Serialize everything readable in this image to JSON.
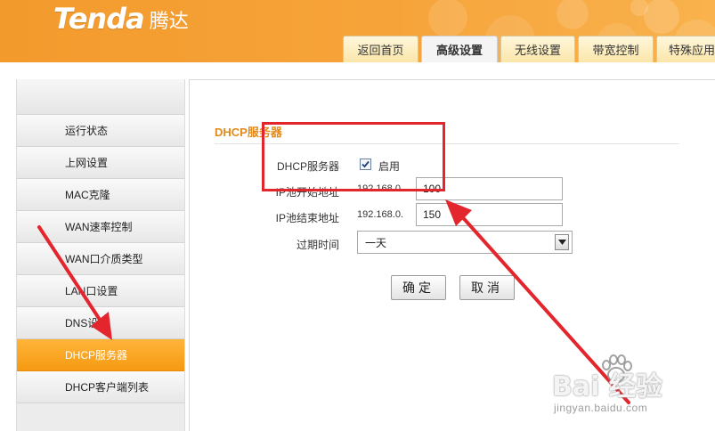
{
  "header": {
    "logo_text": "Tenda",
    "logo_cn": "腾达",
    "tabs": [
      {
        "label": "返回首页",
        "active": false
      },
      {
        "label": "高级设置",
        "active": true
      },
      {
        "label": "无线设置",
        "active": false
      },
      {
        "label": "带宽控制",
        "active": false
      },
      {
        "label": "特殊应用",
        "active": false
      }
    ]
  },
  "sidebar": {
    "items": [
      {
        "label": "运行状态"
      },
      {
        "label": "上网设置"
      },
      {
        "label": "MAC克隆"
      },
      {
        "label": "WAN速率控制"
      },
      {
        "label": "WAN口介质类型"
      },
      {
        "label": "LAN口设置"
      },
      {
        "label": "DNS设置"
      },
      {
        "label": "DHCP服务器",
        "active": true
      },
      {
        "label": "DHCP客户端列表"
      }
    ]
  },
  "main": {
    "section_title": "DHCP服务器",
    "dhcp_server_label": "DHCP服务器",
    "enable_label": "启用",
    "enable_checked": true,
    "ip_start_label": "IP池开始地址",
    "ip_start_prefix": "192.168.0.",
    "ip_start_value": "100",
    "ip_end_label": "IP池结束地址",
    "ip_end_prefix": "192.168.0.",
    "ip_end_value": "150",
    "lease_label": "过期时间",
    "lease_value": "一天",
    "ok_button": "确定",
    "cancel_button": "取消"
  },
  "watermark": {
    "main": "Bai 经验",
    "sub": "jingyan.baidu.com"
  },
  "colors": {
    "header_orange": "#f39a2c",
    "active_menu": "#f59a12",
    "section_title": "#e48a1a",
    "annotation_red": "#e3262d"
  }
}
